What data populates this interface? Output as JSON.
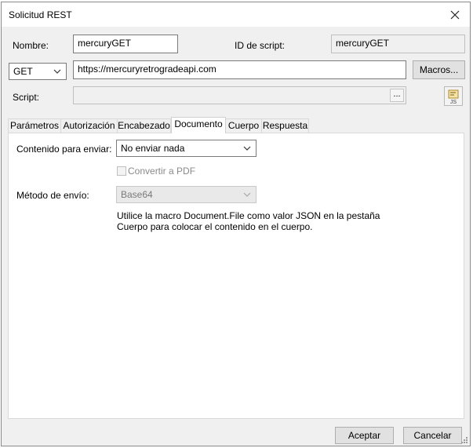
{
  "window": {
    "title": "Solicitud REST"
  },
  "form": {
    "name_label": "Nombre:",
    "name_value": "mercuryGET",
    "script_id_label": "ID de script:",
    "script_id_value": "mercuryGET",
    "method_value": "GET",
    "url_value": "https://mercuryretrogradeapi.com",
    "macros_label": "Macros...",
    "script_label": "Script:",
    "script_value": "",
    "browse_label": "..."
  },
  "tabs": [
    {
      "label": "Parámetros",
      "active": false
    },
    {
      "label": "Autorización",
      "active": false
    },
    {
      "label": "Encabezado",
      "active": false
    },
    {
      "label": "Documento",
      "active": true
    },
    {
      "label": "Cuerpo",
      "active": false
    },
    {
      "label": "Respuesta",
      "active": false
    }
  ],
  "document_tab": {
    "content_label": "Contenido para enviar:",
    "content_value": "No enviar nada",
    "convert_pdf_label": "Convertir a PDF",
    "convert_pdf_checked": false,
    "send_method_label": "Método de envío:",
    "send_method_value": "Base64",
    "note": "Utilice la macro Document.File como valor JSON en la pestaña Cuerpo para colocar el contenido en el cuerpo."
  },
  "footer": {
    "ok_label": "Aceptar",
    "cancel_label": "Cancelar"
  },
  "icons": {
    "close": "close-icon",
    "script_editor": "js-script-icon",
    "dropdown": "chevron-down-icon",
    "resize": "resize-grip-icon"
  }
}
